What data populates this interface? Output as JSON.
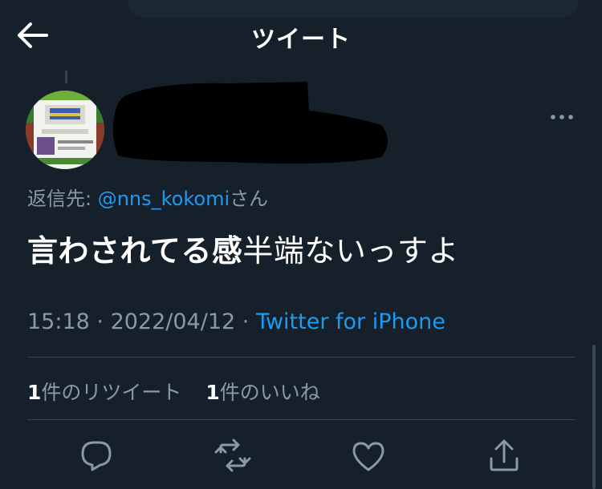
{
  "header": {
    "title": "ツイート",
    "back_icon": "arrow-left-icon"
  },
  "tweet": {
    "reply_prefix": "返信先: ",
    "reply_mention": "@nns_kokomi",
    "reply_suffix": "さん",
    "text_bold": "言わされてる感",
    "text_rest": "半端ないっすよ",
    "time": "15:18",
    "separator": " · ",
    "date": "2022/04/12",
    "source": "Twitter for iPhone"
  },
  "stats": {
    "retweets_count": "1",
    "retweets_label": "件のリツイート",
    "likes_count": "1",
    "likes_label": "件のいいね"
  },
  "actions": {
    "reply_icon": "reply-icon",
    "retweet_icon": "retweet-icon",
    "like_icon": "heart-icon",
    "share_icon": "share-icon"
  },
  "colors": {
    "background": "#15202b",
    "text": "#ffffff",
    "secondary": "#8b98a5",
    "accent": "#1d9bf0",
    "divider": "#38444d"
  }
}
